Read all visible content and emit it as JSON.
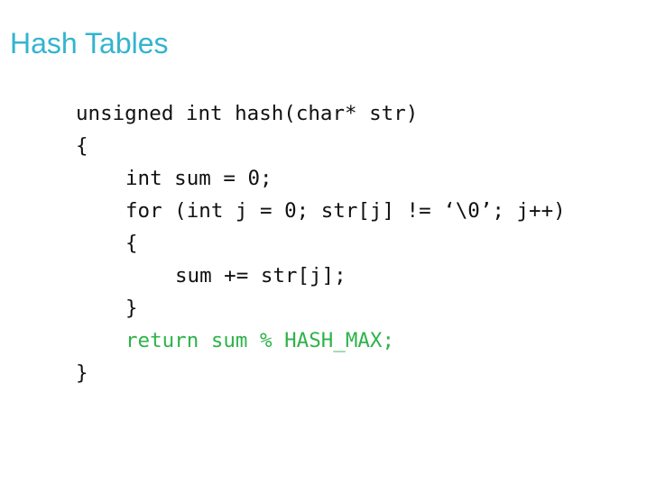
{
  "slide": {
    "title": "Hash Tables",
    "accent_color": "#33b4cf",
    "highlight_color": "#2eb34a",
    "code_lines": [
      {
        "text": "unsigned int hash(char* str)",
        "indent": 0,
        "highlight": false
      },
      {
        "text": "{",
        "indent": 0,
        "highlight": false
      },
      {
        "text": "int sum = 0;",
        "indent": 1,
        "highlight": false
      },
      {
        "text": "for (int j = 0; str[j] != ‘\\0’; j++)",
        "indent": 1,
        "highlight": false
      },
      {
        "text": "{",
        "indent": 1,
        "highlight": false
      },
      {
        "text": "sum += str[j];",
        "indent": 2,
        "highlight": false
      },
      {
        "text": "}",
        "indent": 1,
        "highlight": false
      },
      {
        "text": "return sum % HASH_MAX;",
        "indent": 1,
        "highlight": true
      },
      {
        "text": "}",
        "indent": 0,
        "highlight": false
      }
    ]
  }
}
